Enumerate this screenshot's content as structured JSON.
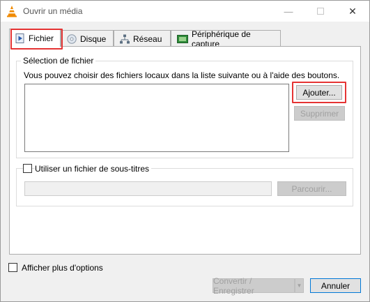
{
  "window": {
    "title": "Ouvrir un média",
    "minimize_glyph": "—",
    "close_glyph": "✕"
  },
  "tabs": [
    {
      "label": "Fichier",
      "icon": "play-file-icon",
      "active": true
    },
    {
      "label": "Disque",
      "icon": "disc-icon",
      "active": false
    },
    {
      "label": "Réseau",
      "icon": "network-icon",
      "active": false
    },
    {
      "label": "Périphérique de capture",
      "icon": "capture-device-icon",
      "active": false
    }
  ],
  "file_selection": {
    "title": "Sélection de fichier",
    "description": "Vous pouvez choisir des fichiers locaux dans la liste suivante ou à l'aide des boutons.",
    "add_button": "Ajouter...",
    "remove_button": "Supprimer"
  },
  "subtitles": {
    "checkbox_label": "Utiliser un fichier de sous-titres",
    "checked": false,
    "browse_button": "Parcourir..."
  },
  "footer": {
    "more_options_label": "Afficher plus d'options",
    "more_options_checked": false,
    "convert_button": "Convertir / Enregistrer",
    "cancel_button": "Annuler"
  },
  "colors": {
    "highlight": "#e53333",
    "vlc_orange": "#f08a00"
  }
}
